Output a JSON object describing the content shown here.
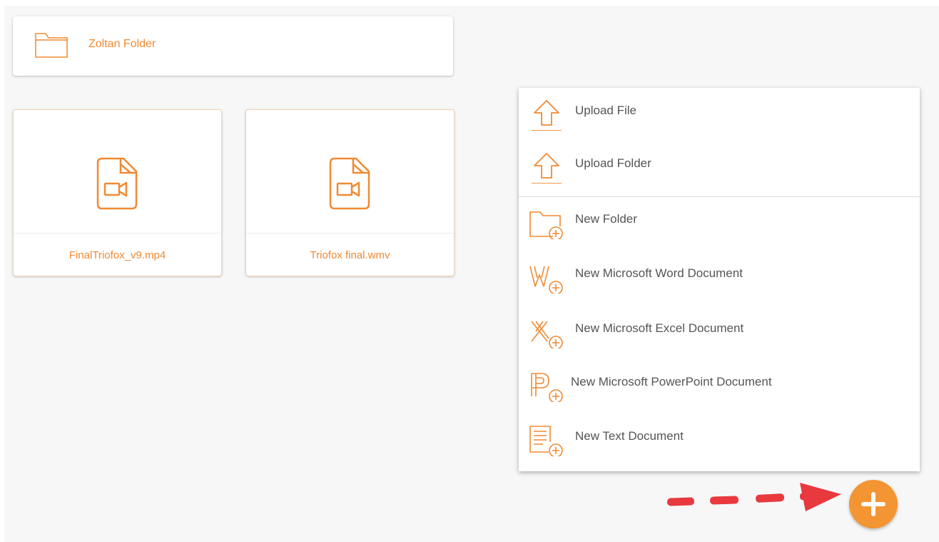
{
  "folders": [
    {
      "name": "Zoltan Folder",
      "icon": "folder-icon"
    }
  ],
  "files": [
    {
      "name": "FinalTriofox_v9.mp4",
      "icon": "video-file-icon"
    },
    {
      "name": "Triofox final.wmv",
      "icon": "video-file-icon"
    }
  ],
  "menu": {
    "upload_file": "Upload File",
    "upload_folder": "Upload Folder",
    "new_folder": "New Folder",
    "new_word": "New Microsoft Word Document",
    "new_excel": "New Microsoft Excel Document",
    "new_powerpoint": "New Microsoft PowerPoint Document",
    "new_text": "New Text Document"
  },
  "fab": {
    "icon": "plus-icon"
  },
  "colors": {
    "accent": "#f08a32",
    "fab": "#f39533",
    "arrow": "#e8393f"
  }
}
